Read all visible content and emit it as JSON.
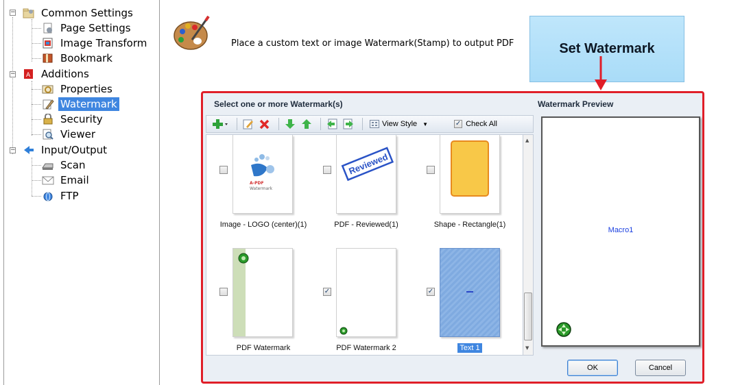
{
  "tree": {
    "items": [
      {
        "label": "Common Settings",
        "icon": "settings-folder-icon"
      },
      {
        "label": "Page Settings",
        "icon": "page-settings-icon"
      },
      {
        "label": "Image Transform",
        "icon": "image-transform-icon"
      },
      {
        "label": "Bookmark",
        "icon": "bookmark-icon"
      },
      {
        "label": "Additions",
        "icon": "pdf-additions-icon"
      },
      {
        "label": "Properties",
        "icon": "properties-icon"
      },
      {
        "label": "Watermark",
        "icon": "watermark-icon"
      },
      {
        "label": "Security",
        "icon": "lock-icon"
      },
      {
        "label": "Viewer",
        "icon": "viewer-icon"
      },
      {
        "label": "Input/Output",
        "icon": "input-output-icon"
      },
      {
        "label": "Scan",
        "icon": "scanner-icon"
      },
      {
        "label": "Email",
        "icon": "envelope-icon"
      },
      {
        "label": "FTP",
        "icon": "ftp-icon"
      }
    ],
    "selected": "Watermark"
  },
  "header": {
    "description": "Place a custom text or image Watermark(Stamp) to output PDF",
    "callout": "Set Watermark"
  },
  "dialog": {
    "list_title": "Select one or more Watermark(s)",
    "preview_title": "Watermark Preview",
    "toolbar": {
      "view_style": "View Style",
      "check_all": "Check All"
    },
    "watermarks": [
      {
        "caption": "Image - LOGO (center)(1)",
        "checked": false,
        "logo_text_1": "A-PDF",
        "logo_text_2": "Watermark"
      },
      {
        "caption": "PDF - Reviewed(1)",
        "checked": false,
        "stamp_text": "Reviewed"
      },
      {
        "caption": "Shape - Rectangle(1)",
        "checked": false
      },
      {
        "caption": "PDF Watermark",
        "checked": false
      },
      {
        "caption": "PDF Watermark 2",
        "checked": true
      },
      {
        "caption": "Text 1",
        "checked": true,
        "selected": true
      }
    ],
    "preview_text": "Macro1",
    "ok_label": "OK",
    "cancel_label": "Cancel"
  },
  "colors": {
    "highlight": "#e01e28",
    "selection": "#3f86e0",
    "callout_bg": "#bfe6fb",
    "preview_text": "#1a3fe0"
  }
}
